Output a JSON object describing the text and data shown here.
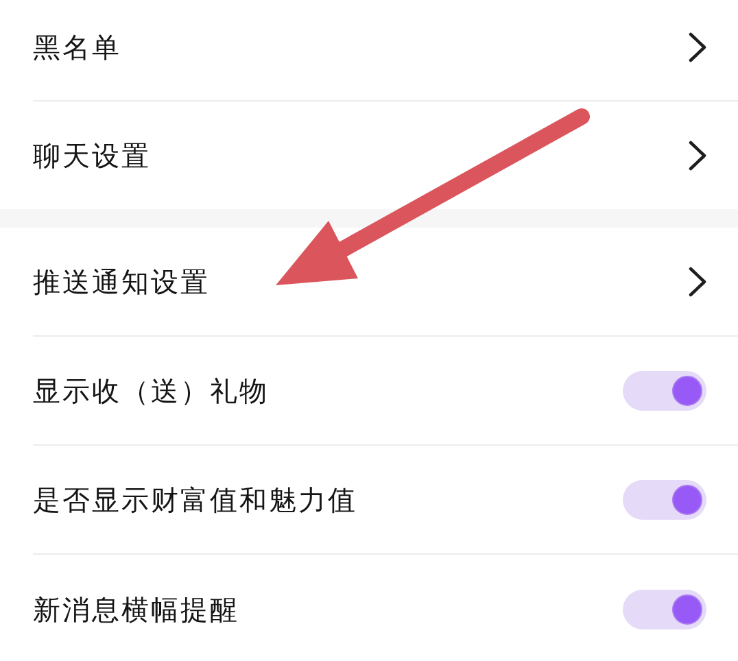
{
  "settings": {
    "groups": [
      {
        "items": [
          {
            "kind": "link",
            "label": "黑名单"
          },
          {
            "kind": "link",
            "label": "聊天设置"
          }
        ]
      },
      {
        "items": [
          {
            "kind": "link",
            "label": "推送通知设置"
          },
          {
            "kind": "toggle",
            "label": "显示收（送）礼物",
            "on": true
          },
          {
            "kind": "toggle",
            "label": "是否显示财富值和魅力值",
            "on": true
          },
          {
            "kind": "toggle",
            "label": "新消息横幅提醒",
            "on": true
          }
        ]
      }
    ]
  }
}
